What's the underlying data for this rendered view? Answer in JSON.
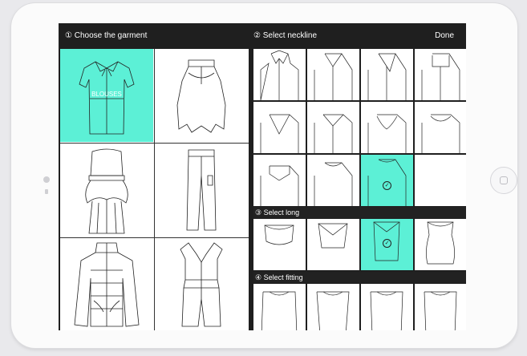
{
  "header": {
    "step1_title": "① Choose the garment",
    "step2_title": "② Select neckline",
    "done_label": "Done"
  },
  "garments": [
    {
      "name": "blouse",
      "label": "BLOUSES",
      "selected": true
    },
    {
      "name": "skirt",
      "selected": false
    },
    {
      "name": "dress",
      "selected": false
    },
    {
      "name": "trousers",
      "selected": false
    },
    {
      "name": "jacket",
      "selected": false
    },
    {
      "name": "jumpsuit",
      "selected": false
    }
  ],
  "sections": {
    "long_title": "③ Select long",
    "fitting_title": "④ Select fitting"
  },
  "neckline": {
    "selected_index": 10,
    "count": 11
  },
  "long": {
    "selected_index": 2,
    "count": 4
  },
  "fitting": {
    "count": 4
  },
  "colors": {
    "accent": "#5cf0d6",
    "header": "#1f1f1f"
  }
}
